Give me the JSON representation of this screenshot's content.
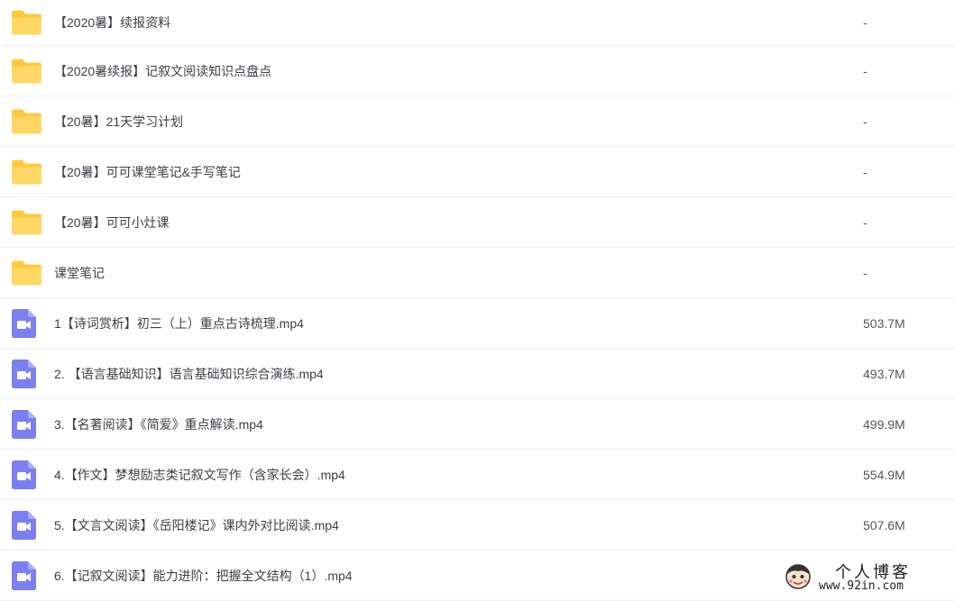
{
  "files": [
    {
      "type": "folder",
      "icon": "folder-icon",
      "name": "【2020暑】续报资料",
      "size": "-"
    },
    {
      "type": "folder",
      "icon": "folder-icon",
      "name": "【2020暑续报】记叙文阅读知识点盘点",
      "size": "-"
    },
    {
      "type": "folder",
      "icon": "folder-icon",
      "name": "【20暑】21天学习计划",
      "size": "-"
    },
    {
      "type": "folder",
      "icon": "folder-icon",
      "name": "【20暑】可可课堂笔记&手写笔记",
      "size": "-"
    },
    {
      "type": "folder",
      "icon": "folder-icon",
      "name": "【20暑】可可小灶课",
      "size": "-"
    },
    {
      "type": "folder",
      "icon": "folder-icon",
      "name": "课堂笔记",
      "size": "-"
    },
    {
      "type": "video",
      "icon": "video-file-icon",
      "name": "1【诗词赏析】初三（上）重点古诗梳理.mp4",
      "size": "503.7M"
    },
    {
      "type": "video",
      "icon": "video-file-icon",
      "name": "2. 【语言基础知识】语言基础知识综合演练.mp4",
      "size": "493.7M"
    },
    {
      "type": "video",
      "icon": "video-file-icon",
      "name": "3.【名著阅读】《简爱》重点解读.mp4",
      "size": "499.9M"
    },
    {
      "type": "video",
      "icon": "video-file-icon",
      "name": "4.【作文】梦想励志类记叙文写作（含家长会）.mp4",
      "size": "554.9M"
    },
    {
      "type": "video",
      "icon": "video-file-icon",
      "name": "5.【文言文阅读】《岳阳楼记》课内外对比阅读.mp4",
      "size": "507.6M"
    },
    {
      "type": "video",
      "icon": "video-file-icon",
      "name": "6.【记叙文阅读】能力进阶：把握全文结构（1）.mp4",
      "size": ""
    }
  ],
  "watermark": {
    "title": "个人博客",
    "url": "www.92in.com"
  },
  "colors": {
    "folder": "#ffd155",
    "video": "#7b80f0",
    "divider": "#eef0f4"
  }
}
